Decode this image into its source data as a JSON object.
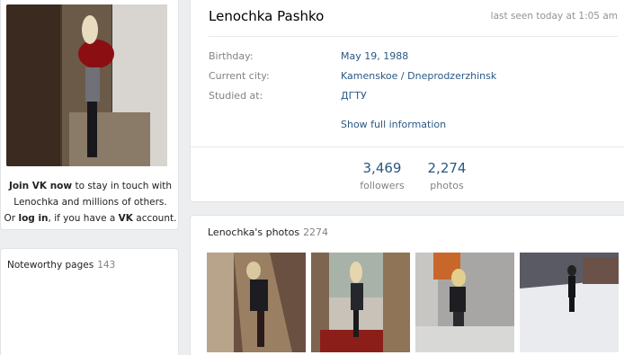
{
  "left": {
    "join_prefix": "Join VK now",
    "join_rest": " to stay in touch with",
    "join_line2": "Lenochka and millions of others.",
    "or": "Or ",
    "log_in": "log in",
    "if_you_have": ", if you have a ",
    "vk": "VK",
    "account": " account.",
    "noteworthy_label": "Noteworthy pages",
    "noteworthy_count": "143"
  },
  "profile": {
    "name": "Lenochka Pashko",
    "last_seen": "last seen today at 1:05 am",
    "info": [
      {
        "label": "Birthday:",
        "value": "May 19, 1988"
      },
      {
        "label": "Current city:",
        "value": "Kamenskoe / Dneprodzerzhinsk"
      },
      {
        "label": "Studied at:",
        "value": "ДГТУ"
      }
    ],
    "show_full": "Show full information",
    "counters": [
      {
        "num": "3,469",
        "label": "followers"
      },
      {
        "num": "2,274",
        "label": "photos"
      }
    ]
  },
  "photos": {
    "title": "Lenochka's photos",
    "count": "2274"
  },
  "colors": {
    "link": "#2a5885",
    "muted": "#828282",
    "background": "#edeef0"
  }
}
